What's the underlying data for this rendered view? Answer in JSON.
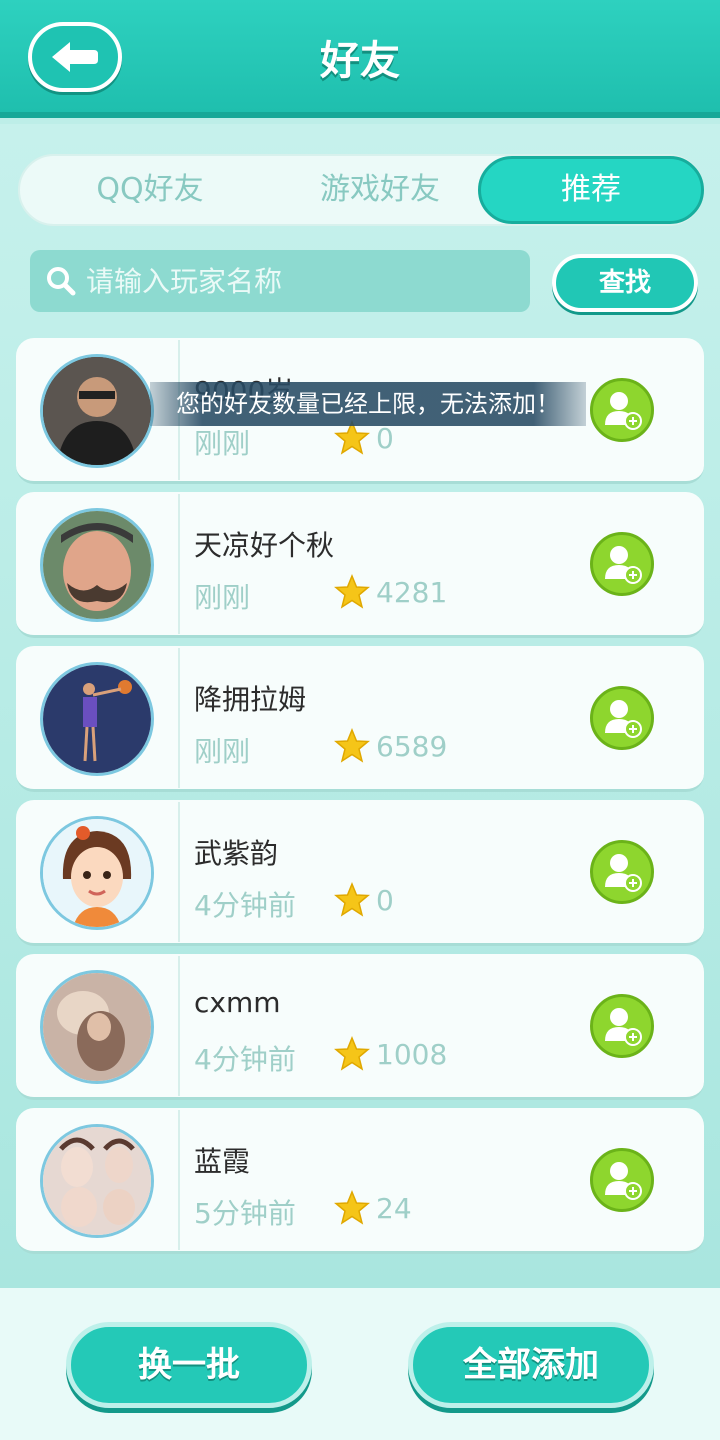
{
  "header": {
    "title": "好友",
    "back_icon": "back-arrow-icon"
  },
  "tabs": [
    {
      "label": "QQ好友",
      "active": false
    },
    {
      "label": "游戏好友",
      "active": false
    },
    {
      "label": "推荐",
      "active": true
    }
  ],
  "search": {
    "placeholder": "请输入玩家名称",
    "button_label": "查找"
  },
  "players": [
    {
      "name": "9000岁",
      "time": "刚刚",
      "score": "0",
      "avatar": "photo-man-glasses"
    },
    {
      "name": "天凉好个秋",
      "time": "刚刚",
      "score": "4281",
      "avatar": "photo-man-mustache"
    },
    {
      "name": "降拥拉姆",
      "time": "刚刚",
      "score": "6589",
      "avatar": "illustration-basketball"
    },
    {
      "name": "武紫韵",
      "time": "4分钟前",
      "score": "0",
      "avatar": "cartoon-girl"
    },
    {
      "name": "cxmm",
      "time": "4分钟前",
      "score": "1008",
      "avatar": "photo-blurry"
    },
    {
      "name": "蓝霞",
      "time": "5分钟前",
      "score": "24",
      "avatar": "photo-faces"
    }
  ],
  "toast": "您的好友数量已经上限，无法添加！",
  "footer": {
    "refresh_label": "换一批",
    "add_all_label": "全部添加"
  },
  "colors": {
    "accent": "#25d6c3",
    "add_button": "#8ed62e",
    "star": "#f5c518"
  }
}
